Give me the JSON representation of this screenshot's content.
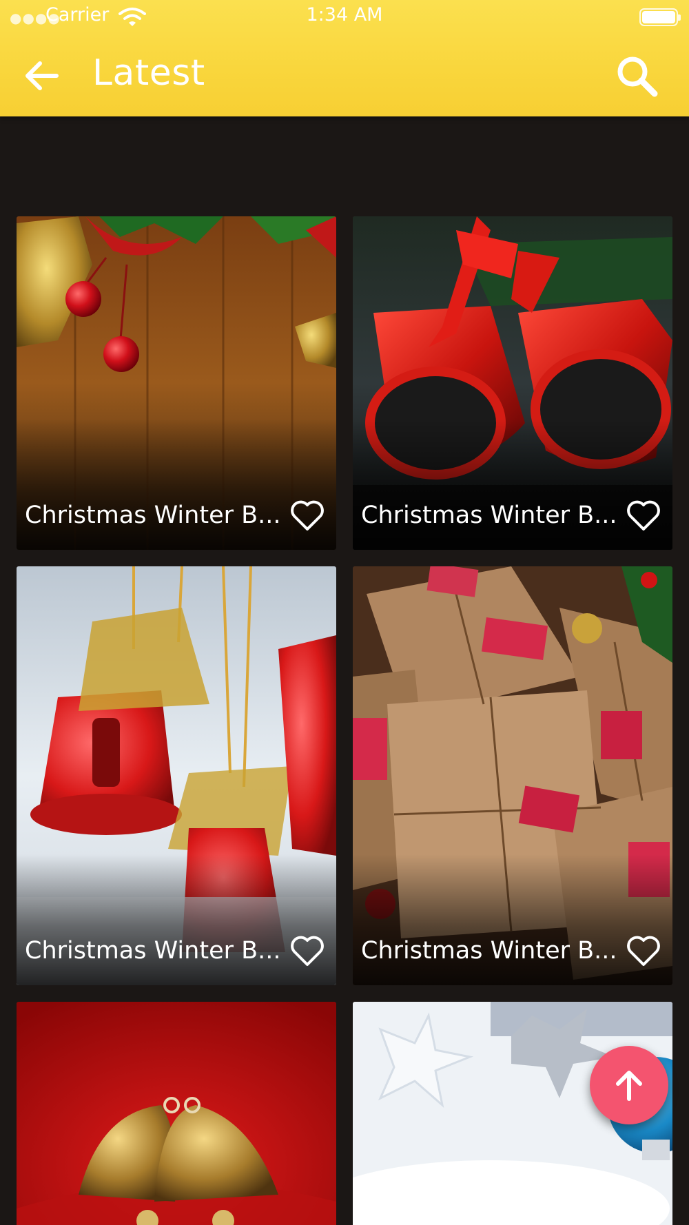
{
  "status_bar": {
    "carrier": "Carrier",
    "time": "1:34 AM"
  },
  "header": {
    "title": "Latest"
  },
  "colors": {
    "header": "#f9d63c",
    "background": "#1b1715",
    "fab": "#f4546f"
  },
  "cards": [
    {
      "title": "Christmas Winter B...",
      "liked": false,
      "image": "gold bells and red berries on wood"
    },
    {
      "title": "Christmas Winter B...",
      "liked": false,
      "image": "red ribbon bells with pine"
    },
    {
      "title": "Christmas Winter B...",
      "liked": false,
      "image": "red bells with gold tinsel in snow"
    },
    {
      "title": "Christmas Winter B...",
      "liked": false,
      "image": "kraft paper gift boxes with red tags"
    },
    {
      "title": "",
      "liked": false,
      "image": "golden bells on red"
    },
    {
      "title": "",
      "liked": false,
      "image": "silver stars and ornaments on snow"
    }
  ],
  "icons": {
    "back": "arrow-left-icon",
    "search": "search-icon",
    "like": "heart-outline-icon",
    "scroll_top": "arrow-up-icon"
  }
}
